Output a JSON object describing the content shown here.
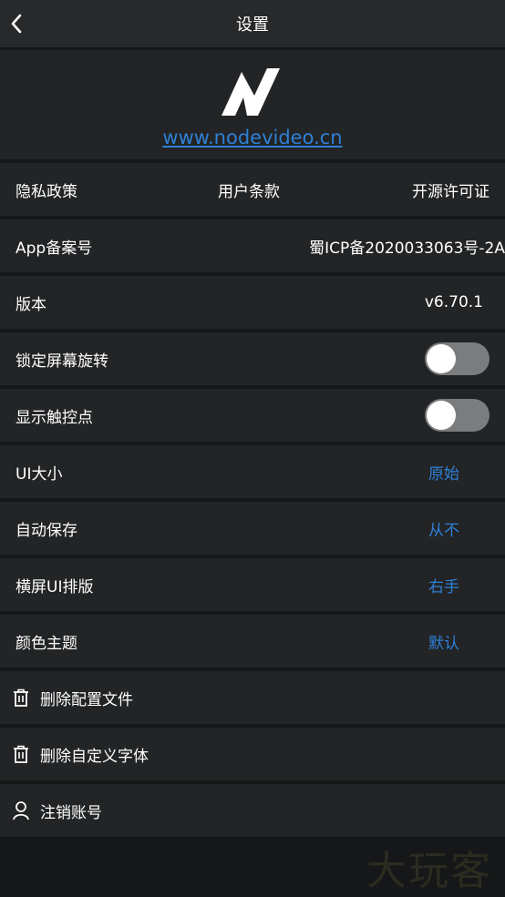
{
  "header": {
    "title": "设置",
    "back_icon": "chevron-left-icon"
  },
  "logo": {
    "icon": "nodevideo-logo-icon",
    "website": "www.nodevideo.cn"
  },
  "links": {
    "privacy": "隐私政策",
    "terms": "用户条款",
    "open_source": "开源许可证"
  },
  "settings": {
    "icp_label": "App备案号",
    "icp_value": "蜀ICP备2020033063号-2A",
    "version_label": "版本",
    "version_value": "v6.70.1",
    "lock_rotation_label": "锁定屏幕旋转",
    "lock_rotation_on": false,
    "show_touches_label": "显示触控点",
    "show_touches_on": false,
    "ui_size_label": "UI大小",
    "ui_size_value": "原始",
    "autosave_label": "自动保存",
    "autosave_value": "从不",
    "landscape_label": "横屏UI排版",
    "landscape_value": "右手",
    "theme_label": "颜色主题",
    "theme_value": "默认"
  },
  "actions": {
    "delete_config": "删除配置文件",
    "delete_fonts": "删除自定义字体",
    "cancel_account": "注销账号"
  },
  "watermark": "大玩客",
  "colors": {
    "accent_blue": "#2f80d6",
    "background": "#161718",
    "row_background": "#222426",
    "header_background": "#28292b",
    "toggle_off": "#7b7c7e"
  }
}
